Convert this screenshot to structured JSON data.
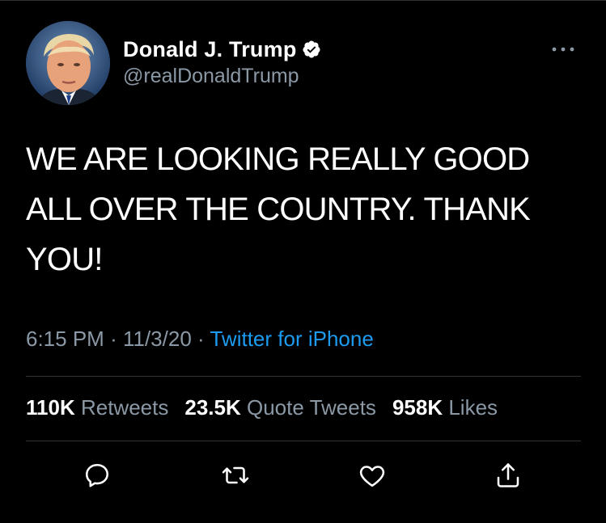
{
  "author": {
    "display_name": "Donald J. Trump",
    "handle": "@realDonaldTrump",
    "verified": true
  },
  "tweet": {
    "text": "WE ARE LOOKING REALLY GOOD ALL OVER THE COUNTRY. THANK YOU!",
    "time": "6:15 PM",
    "separator": "·",
    "date": "11/3/20",
    "source": "Twitter for iPhone"
  },
  "stats": {
    "retweets_count": "110K",
    "retweets_label": "Retweets",
    "quotes_count": "23.5K",
    "quotes_label": "Quote Tweets",
    "likes_count": "958K",
    "likes_label": "Likes"
  },
  "actions": {
    "reply_icon": "reply-icon",
    "retweet_icon": "retweet-icon",
    "like_icon": "heart-icon",
    "share_icon": "share-icon"
  },
  "colors": {
    "background": "#000000",
    "text": "#ffffff",
    "secondary_text": "#8b98a5",
    "link": "#1d9bf0",
    "divider": "#2f3336"
  }
}
